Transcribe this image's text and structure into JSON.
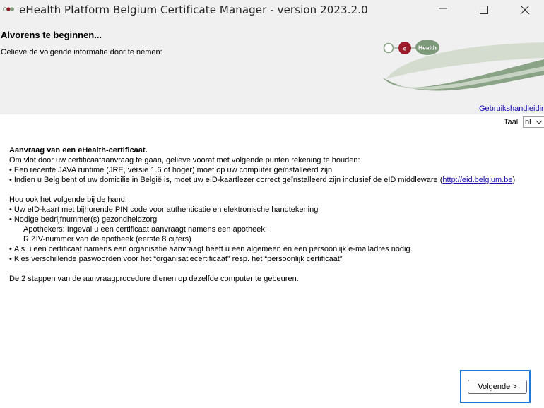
{
  "window": {
    "title": "eHealth Platform Belgium Certificate Manager - version 2023.2.0",
    "icon": "app-logo-icon",
    "controls": [
      "minimize-icon",
      "maximize-icon",
      "close-icon"
    ]
  },
  "header": {
    "title": "Alvorens te beginnen...",
    "subtitle": "Gelieve de volgende informatie door te nemen:",
    "logo_text": "Health",
    "logo_badge": "e",
    "manual_link": "Gebruikshandleiding",
    "colors": {
      "logo_green": "#7d9a7a",
      "logo_red": "#9a1b2a"
    }
  },
  "language": {
    "label": "Taal",
    "selected": "nl"
  },
  "content": {
    "heading": "Aanvraag van een eHealth-certificaat.",
    "intro": "Om vlot door uw certificaataanvraag te gaan, gelieve vooraf met volgende punten rekening te houden:",
    "req1": "Een recente JAVA runtime (JRE, versie 1.6 of hoger) moet op uw computer geïnstalleerd zijn",
    "req2_pre": "Indien u Belg bent of uw domicilie in België is, moet uw eID-kaartlezer correct geïnstalleerd zijn inclusief de eID middleware (",
    "req2_link": "http://eid.belgium.be",
    "req2_post": ")",
    "keep_heading": "Hou ook het volgende bij de hand:",
    "item1": "Uw eID-kaart met bijhorende PIN code voor authenticatie en elektronische handtekening",
    "item2": "Nodige bedrijfnummer(s) gezondheidzorg",
    "item2_sub1": "Apothekers: Ingeval u een certificaat aanvraagt namens een apotheek:",
    "item2_sub2": "RIZIV-nummer van de apotheek (eerste 8 cijfers)",
    "item3": "Als u een certificaat namens een organisatie aanvraagt heeft u een algemeen en een persoonlijk e-mailadres nodig.",
    "item4": "Kies verschillende paswoorden voor het “organisatiecertificaat” resp. het “persoonlijk certificaat”",
    "footer": "De 2 stappen van de aanvraagprocedure dienen op dezelfde computer te gebeuren."
  },
  "buttons": {
    "next": "Volgende >"
  }
}
